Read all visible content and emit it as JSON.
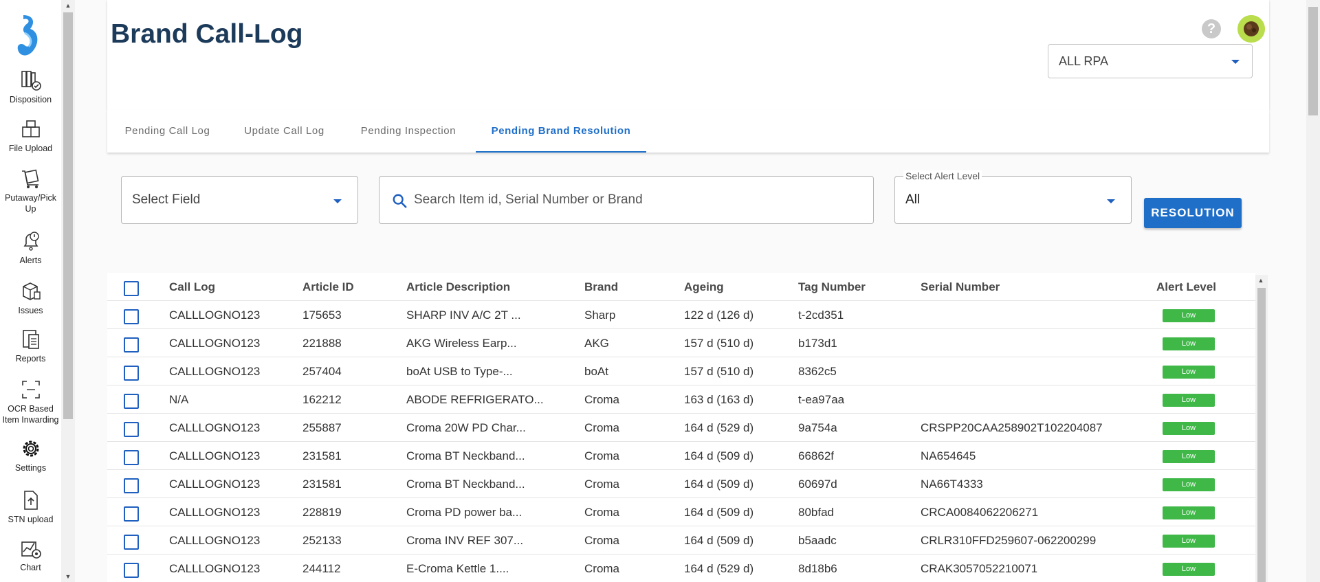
{
  "sidebar": {
    "items": [
      {
        "label": "Disposition",
        "icon": "disposition-icon"
      },
      {
        "label": "File Upload",
        "icon": "file-upload-icon"
      },
      {
        "label": "Putaway/Pick Up",
        "icon": "putaway-icon"
      },
      {
        "label": "Alerts",
        "icon": "alerts-icon"
      },
      {
        "label": "Issues",
        "icon": "issues-icon"
      },
      {
        "label": "Reports",
        "icon": "reports-icon"
      },
      {
        "label": "OCR Based Item Inwarding",
        "icon": "ocr-icon"
      },
      {
        "label": "Settings",
        "icon": "gear-icon"
      },
      {
        "label": "STN upload",
        "icon": "stn-upload-icon"
      },
      {
        "label": "Chart",
        "icon": "chart-icon"
      }
    ]
  },
  "header": {
    "title": "Brand Call-Log",
    "help": "?",
    "rpa_select": "ALL RPA"
  },
  "tabs": [
    {
      "label": "Pending Call Log",
      "active": false
    },
    {
      "label": "Update Call Log",
      "active": false
    },
    {
      "label": "Pending Inspection",
      "active": false
    },
    {
      "label": "Pending Brand Resolution",
      "active": true
    }
  ],
  "filters": {
    "field_select": "Select Field",
    "search_placeholder": "Search Item id, Serial Number or Brand",
    "alert_label": "Select Alert Level",
    "alert_value": "All",
    "resolution_button": "RESOLUTION"
  },
  "table": {
    "columns": [
      "Call Log",
      "Article ID",
      "Article Description",
      "Brand",
      "Ageing",
      "Tag Number",
      "Serial Number",
      "Alert Level"
    ],
    "rows": [
      [
        "CALLLOGNO123",
        "175653",
        "SHARP INV A/C 2T ...",
        "Sharp",
        "122 d (126 d)",
        "t-2cd351",
        "",
        "Low"
      ],
      [
        "CALLLOGNO123",
        "221888",
        "AKG Wireless Earp...",
        "AKG",
        "157 d (510 d)",
        "b173d1",
        "",
        "Low"
      ],
      [
        "CALLLOGNO123",
        "257404",
        "boAt USB to Type-...",
        "boAt",
        "157 d (510 d)",
        "8362c5",
        "",
        "Low"
      ],
      [
        "N/A",
        "162212",
        "ABODE REFRIGERATO...",
        "Croma",
        "163 d (163 d)",
        "t-ea97aa",
        "",
        "Low"
      ],
      [
        "CALLLOGNO123",
        "255887",
        "Croma 20W PD Char...",
        "Croma",
        "164 d (529 d)",
        "9a754a",
        "CRSPP20CAA258902T102204087",
        "Low"
      ],
      [
        "CALLLOGNO123",
        "231581",
        "Croma BT Neckband...",
        "Croma",
        "164 d (509 d)",
        "66862f",
        "NA654645",
        "Low"
      ],
      [
        "CALLLOGNO123",
        "231581",
        "Croma BT Neckband...",
        "Croma",
        "164 d (509 d)",
        "60697d",
        "NA66T4333",
        "Low"
      ],
      [
        "CALLLOGNO123",
        "228819",
        "Croma PD power ba...",
        "Croma",
        "164 d (509 d)",
        "80bfad",
        "CRCA0084062206271",
        "Low"
      ],
      [
        "CALLLOGNO123",
        "252133",
        "Croma INV REF 307...",
        "Croma",
        "164 d (509 d)",
        "b5aadc",
        "CRLR310FFD259607-062200299",
        "Low"
      ],
      [
        "CALLLOGNO123",
        "244112",
        "E-Croma Kettle 1....",
        "Croma",
        "164 d (529 d)",
        "8d18b6",
        "CRAK3057052210071",
        "Low"
      ]
    ]
  },
  "colors": {
    "accent": "#1f6fc9",
    "title": "#1c3a59",
    "alert_low": "#3fb848"
  }
}
